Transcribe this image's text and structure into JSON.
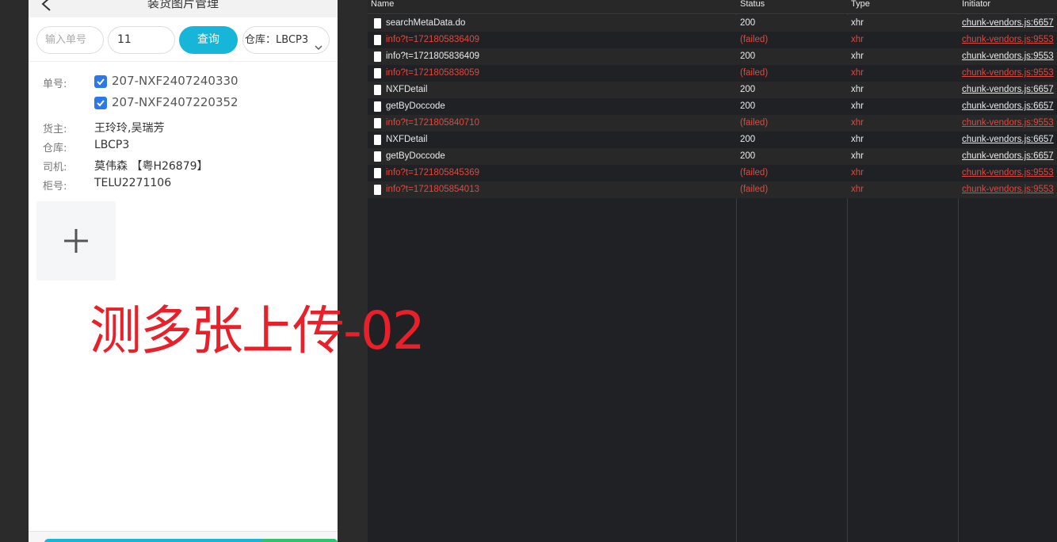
{
  "app": {
    "page_title": "装货图片管理"
  },
  "search": {
    "order_placeholder": "输入单号",
    "qty_value": "11",
    "query_label": "查询",
    "warehouse_label": "仓库：",
    "warehouse_value": "LBCP3"
  },
  "details": {
    "order_label": "单号:",
    "orders": [
      "207-NXF2407240330",
      "207-NXF2407220352"
    ],
    "owner_label": "货主:",
    "owner_value": "王玲玲,吴瑞芳",
    "warehouse_label": "仓库:",
    "warehouse_value": "LBCP3",
    "driver_label": "司机:",
    "driver_value": "莫伟森 【粤H26879】",
    "container_label": "柜号:",
    "container_value": "TELU2271106"
  },
  "overlay": {
    "caption": "测多张上传-02"
  },
  "network": {
    "columns": [
      "Name",
      "Status",
      "Type",
      "Initiator"
    ],
    "rows": [
      {
        "name": "searchMetaData.do",
        "status": "200",
        "type": "xhr",
        "initiator": "chunk-vendors.js:6657",
        "failed": false
      },
      {
        "name": "info?t=1721805836409",
        "status": "(failed)",
        "type": "xhr",
        "initiator": "chunk-vendors.js:9553",
        "failed": true
      },
      {
        "name": "info?t=1721805836409",
        "status": "200",
        "type": "xhr",
        "initiator": "chunk-vendors.js:9553",
        "failed": false
      },
      {
        "name": "info?t=1721805838059",
        "status": "(failed)",
        "type": "xhr",
        "initiator": "chunk-vendors.js:9553",
        "failed": true
      },
      {
        "name": "NXFDetail",
        "status": "200",
        "type": "xhr",
        "initiator": "chunk-vendors.js:6657",
        "failed": false
      },
      {
        "name": "getByDoccode",
        "status": "200",
        "type": "xhr",
        "initiator": "chunk-vendors.js:6657",
        "failed": false
      },
      {
        "name": "info?t=1721805840710",
        "status": "(failed)",
        "type": "xhr",
        "initiator": "chunk-vendors.js:9553",
        "failed": true
      },
      {
        "name": "NXFDetail",
        "status": "200",
        "type": "xhr",
        "initiator": "chunk-vendors.js:6657",
        "failed": false
      },
      {
        "name": "getByDoccode",
        "status": "200",
        "type": "xhr",
        "initiator": "chunk-vendors.js:6657",
        "failed": false
      },
      {
        "name": "info?t=1721805845369",
        "status": "(failed)",
        "type": "xhr",
        "initiator": "chunk-vendors.js:9553",
        "failed": true
      },
      {
        "name": "info?t=1721805854013",
        "status": "(failed)",
        "type": "xhr",
        "initiator": "chunk-vendors.js:9553",
        "failed": true
      }
    ]
  },
  "colors": {
    "accent": "#17b6d8",
    "checkbox": "#2a79e8",
    "caption": "#e8202a",
    "failed": "#e4473c"
  }
}
